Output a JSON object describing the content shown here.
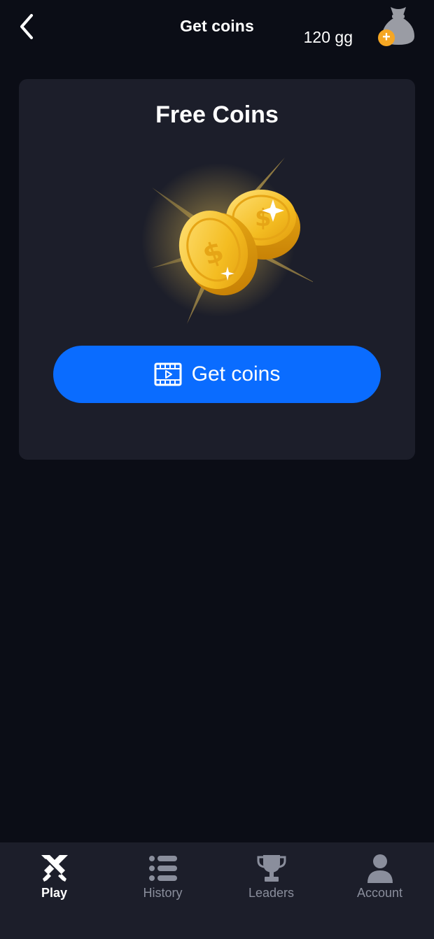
{
  "header": {
    "title": "Get coins",
    "balance": "120 gg"
  },
  "card": {
    "title": "Free Coins",
    "button_label": "Get coins"
  },
  "nav": {
    "items": [
      {
        "label": "Play",
        "icon": "swords-icon",
        "active": true
      },
      {
        "label": "History",
        "icon": "list-icon",
        "active": false
      },
      {
        "label": "Leaders",
        "icon": "trophy-icon",
        "active": false
      },
      {
        "label": "Account",
        "icon": "person-icon",
        "active": false
      }
    ]
  },
  "colors": {
    "background": "#0b0d16",
    "card": "#1c1e2a",
    "accent": "#0a6cff",
    "plus_badge": "#f5a623",
    "inactive": "#8a8e9c"
  }
}
